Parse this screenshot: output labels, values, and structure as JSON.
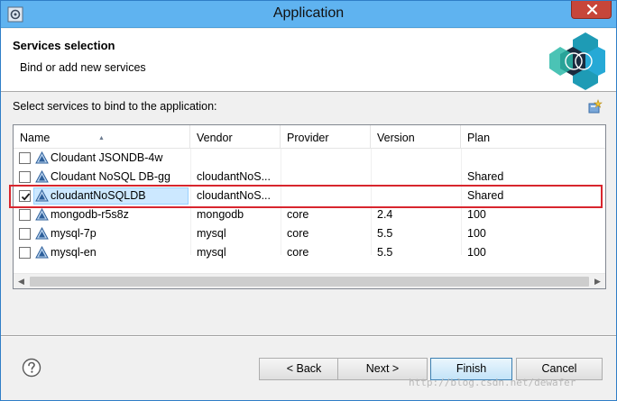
{
  "window": {
    "title": "Application"
  },
  "header": {
    "title": "Services selection",
    "subtitle": "Bind or add new services"
  },
  "prompt": "Select services to bind to the application:",
  "table": {
    "columns": [
      "Name",
      "Vendor",
      "Provider",
      "Version",
      "Plan"
    ],
    "rows": [
      {
        "name": "Cloudant JSONDB-4w",
        "vendor": "",
        "provider": "",
        "version": "",
        "plan": "",
        "checked": false
      },
      {
        "name": "Cloudant NoSQL DB-gg",
        "vendor": "cloudantNoS...",
        "provider": "",
        "version": "",
        "plan": "Shared",
        "checked": false
      },
      {
        "name": "cloudantNoSQLDB",
        "vendor": "cloudantNoS...",
        "provider": "",
        "version": "",
        "plan": "Shared",
        "checked": true
      },
      {
        "name": "mongodb-r5s8z",
        "vendor": "mongodb",
        "provider": "core",
        "version": "2.4",
        "plan": "100",
        "checked": false
      },
      {
        "name": "mysql-7p",
        "vendor": "mysql",
        "provider": "core",
        "version": "5.5",
        "plan": "100",
        "checked": false
      },
      {
        "name": "mysql-en",
        "vendor": "mysql",
        "provider": "core",
        "version": "5.5",
        "plan": "100",
        "checked": false
      }
    ]
  },
  "buttons": {
    "back": "< Back",
    "next": "Next >",
    "finish": "Finish",
    "cancel": "Cancel"
  },
  "watermark": "http://blog.csdn.net/dewafer",
  "colors": {
    "titlebar": "#5fb3f0",
    "close": "#c7463a",
    "selection": "#cce8ff",
    "highlight": "#d8262e"
  }
}
